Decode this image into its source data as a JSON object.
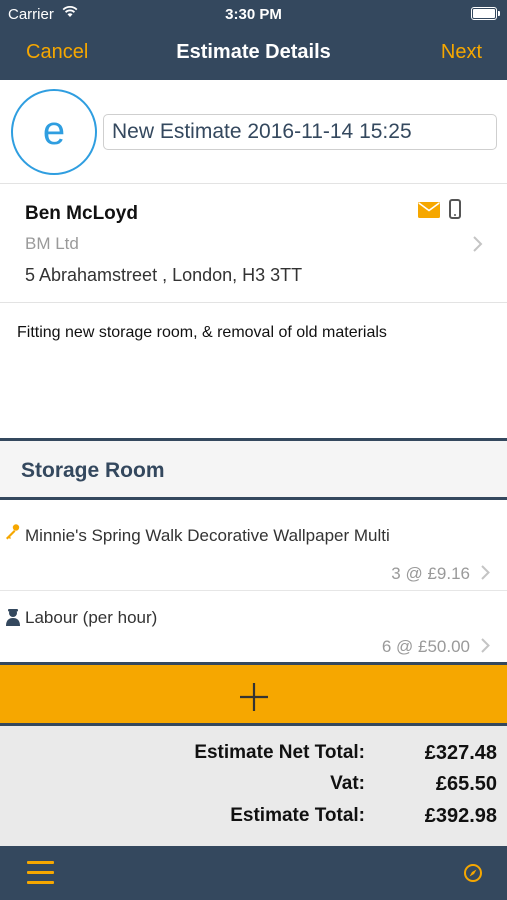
{
  "status_bar": {
    "carrier": "Carrier",
    "time": "3:30 PM",
    "wifi_icon": "wifi-icon",
    "battery_icon": "battery-icon"
  },
  "nav": {
    "cancel": "Cancel",
    "title": "Estimate Details",
    "next": "Next"
  },
  "estimate": {
    "avatar_letter": "e",
    "name": "New Estimate 2016-11-14 15:25"
  },
  "customer": {
    "name": "Ben McLoyd",
    "company": "BM Ltd",
    "address": "5 Abrahamstreet , London, H3 3TT",
    "icons": [
      "mail-icon",
      "phone-icon",
      "chevron-right-icon"
    ]
  },
  "description": "Fitting new storage room, & removal of old materials",
  "section": {
    "title": "Storage Room"
  },
  "items": [
    {
      "icon": "key-icon",
      "description": "Minnie's Spring Walk Decorative Wallpaper Multi",
      "quantity_price": "3 @ £9.16"
    },
    {
      "icon": "worker-icon",
      "description": "Labour (per hour)",
      "quantity_price": "6 @ £50.00"
    }
  ],
  "add_button_icon": "plus-icon",
  "totals": {
    "net_label": "Estimate Net Total:",
    "net_value": "£327.48",
    "vat_label": "Vat:",
    "vat_value": "£65.50",
    "total_label": "Estimate Total:",
    "total_value": "£392.98"
  },
  "toolbar": {
    "menu_icon": "hamburger-menu-icon",
    "compass_icon": "compass-icon"
  },
  "colors": {
    "nav_background": "#34485e",
    "accent": "#f6a700",
    "avatar_blue": "#2f9ee0"
  }
}
